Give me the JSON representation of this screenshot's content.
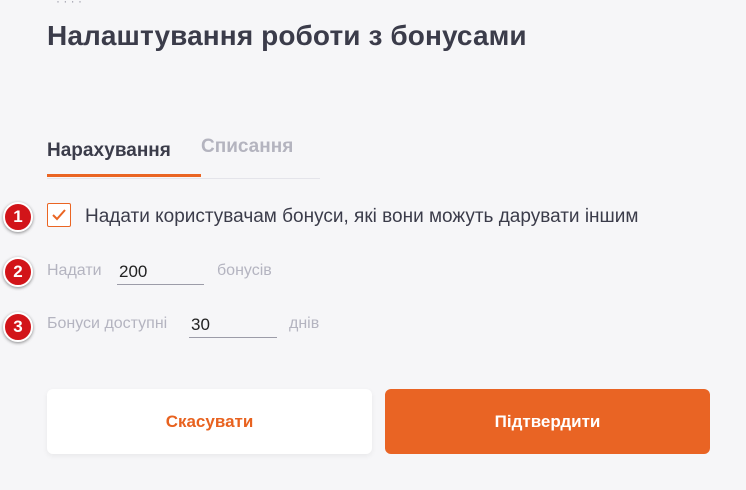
{
  "header": {
    "top_fragment": "· · · ·",
    "title": "Налаштування роботи з бонусами"
  },
  "tabs": [
    {
      "label": "Нарахування",
      "active": true
    },
    {
      "label": "Списання",
      "active": false
    }
  ],
  "markers": [
    "1",
    "2",
    "3"
  ],
  "form": {
    "gift_checkbox": {
      "label": "Надати користувачам бонуси, які вони можуть дарувати іншим",
      "checked": true
    },
    "give": {
      "prefix": "Надати",
      "value": "200",
      "suffix": "бонусів"
    },
    "available": {
      "prefix": "Бонуси доступні",
      "value": "30",
      "suffix": "днів"
    }
  },
  "buttons": {
    "cancel": "Скасувати",
    "confirm": "Підтвердити"
  },
  "colors": {
    "accent": "#e96424",
    "marker": "#d21419",
    "background": "#f6f6f8"
  }
}
